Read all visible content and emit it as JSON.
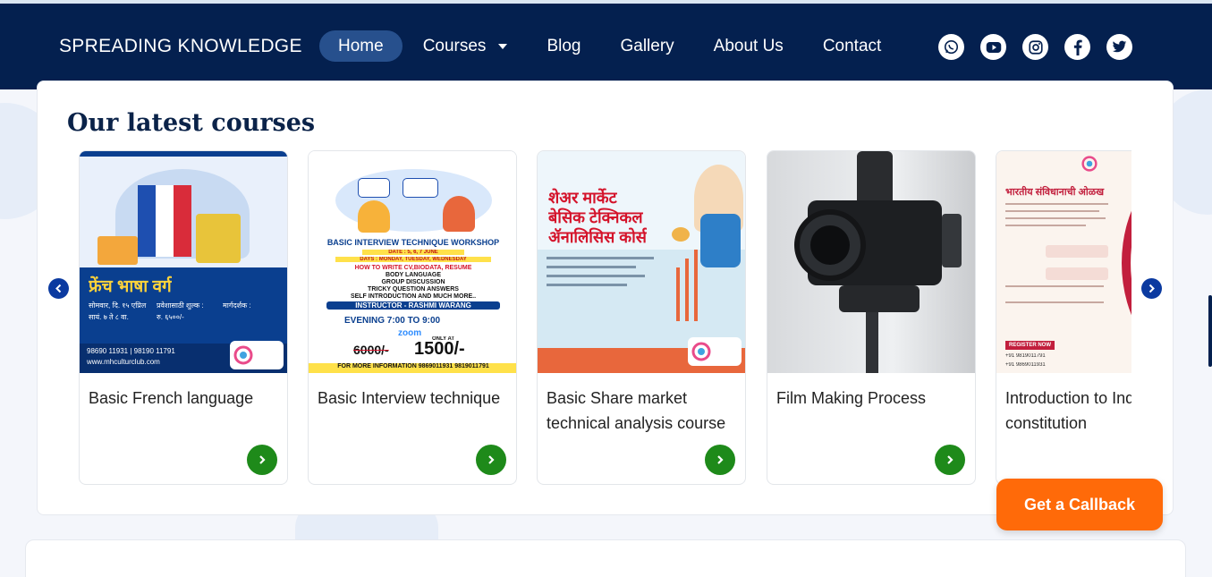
{
  "header": {
    "brand": "SPREADING KNOWLEDGE",
    "nav": [
      {
        "label": "Home",
        "active": true
      },
      {
        "label": "Courses",
        "has_dropdown": true
      },
      {
        "label": "Blog"
      },
      {
        "label": "Gallery"
      },
      {
        "label": "About Us"
      },
      {
        "label": "Contact"
      }
    ],
    "social_icons": [
      "whatsapp-icon",
      "youtube-icon",
      "instagram-icon",
      "facebook-icon",
      "twitter-icon"
    ]
  },
  "section": {
    "title": "Our latest courses"
  },
  "courses": [
    {
      "title": "Basic French language",
      "poster": {
        "heading": "फ्रेंच भाषा वर्ग",
        "detail1": "सोमवार, दि. १५ एप्रिल",
        "detail2": "सायं. ७ ते ८ वा.",
        "fee_label": "प्रवेशासाठी शुल्क :",
        "fee_value": "रु. ६५००/-",
        "venue_label": "मार्गदर्शक :",
        "phone": "98690 11931 | 98190 11791",
        "website": "www.mhculturclub.com"
      }
    },
    {
      "title": "Basic Interview technique",
      "poster": {
        "heading": "BASIC INTERVIEW TECHNIQUE WORKSHOP",
        "date": "DATE : 5, 6, 7 JUNE",
        "days": "DAYS : MONDAY, TUESDAY, WEDNESDAY",
        "topics": [
          "HOW TO WRITE CV,BIODATA, RESUME",
          "BODY LANGUAGE",
          "GROUP DISCUSSION",
          "TRICKY QUESTION ANSWERS",
          "SELF INTRODUCTION AND MUCH MORE.."
        ],
        "instructor": "INSTRUCTOR - RASHMI WARANG",
        "time": "EVENING 7:00 TO 9:00",
        "platform": "zoom",
        "old_price": "6000/-",
        "offer_label": "ONLY AT",
        "price": "1500/-",
        "footer": "FOR MORE INFORMATION 9869011931 9819011791"
      }
    },
    {
      "title": "Basic Share market technical analysis course",
      "poster": {
        "heading1": "शेअर मार्केट",
        "heading2": "बेसिक टेक्निकल",
        "heading3": "ॲनालिसिस कोर्स"
      }
    },
    {
      "title": "Film Making Process",
      "poster": {}
    },
    {
      "title": "Introduction to Indian constitution",
      "poster": {
        "heading": "भारतीय संविधानाची ओळख",
        "cta": "REGISTER NOW",
        "phone1": "+91 9819011791",
        "phone2": "+91 9869011931"
      }
    }
  ],
  "callback": {
    "label": "Get a Callback"
  },
  "colors": {
    "header_bg": "#04204f",
    "nav_active": "#27508d",
    "go_button": "#1e8a1a",
    "carousel_arrow": "#0b3aa0",
    "callback_bg": "#ff6a09",
    "title_color": "#0b2349"
  }
}
